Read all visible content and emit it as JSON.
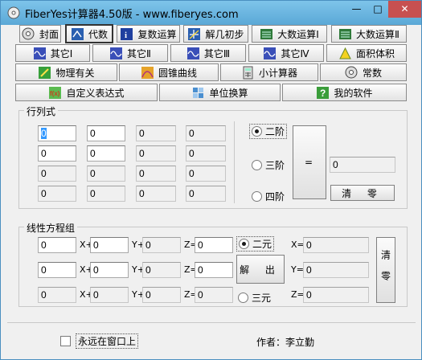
{
  "window": {
    "title": "FiberYes计算器4.50版 - www.fiberyes.com",
    "minimize": "—",
    "maximize": "□",
    "close": "✕"
  },
  "toolbar": {
    "row1": [
      {
        "label": "封面",
        "icon": "disc-icon"
      },
      {
        "label": "代数",
        "icon": "abacus-icon",
        "active": true
      },
      {
        "label": "复数运算",
        "icon": "info-icon"
      },
      {
        "label": "解几初步",
        "icon": "axes-icon"
      },
      {
        "label": "大数运算Ⅰ",
        "icon": "bignum-icon"
      },
      {
        "label": "大数运算Ⅱ",
        "icon": "bignum-icon"
      }
    ],
    "row2": [
      {
        "label": "其它Ⅰ",
        "icon": "wave-icon"
      },
      {
        "label": "其它Ⅱ",
        "icon": "wave-icon"
      },
      {
        "label": "其它Ⅲ",
        "icon": "wave-icon"
      },
      {
        "label": "其它Ⅳ",
        "icon": "wave-icon"
      },
      {
        "label": "面积体积",
        "icon": "triangle-icon"
      }
    ],
    "row3": [
      {
        "label": "物理有关",
        "icon": "physics-icon"
      },
      {
        "label": "圆锥曲线",
        "icon": "conic-icon"
      },
      {
        "label": "小计算器",
        "icon": "calculator-icon"
      },
      {
        "label": "常数",
        "icon": "disc-icon"
      }
    ],
    "row4": [
      {
        "label": "自定义表达式",
        "icon": "fx-icon"
      },
      {
        "label": "单位换算",
        "icon": "units-icon"
      },
      {
        "label": "我的软件",
        "icon": "help-icon"
      }
    ]
  },
  "determinant": {
    "title": "行列式",
    "cells": [
      [
        "0",
        "0",
        "0",
        "0"
      ],
      [
        "0",
        "0",
        "0",
        "0"
      ],
      [
        "0",
        "0",
        "0",
        "0"
      ],
      [
        "0",
        "0",
        "0",
        "0"
      ]
    ],
    "orders": [
      "二阶",
      "三阶",
      "四阶"
    ],
    "selected_order": "二阶",
    "equals_label": "=",
    "result": "0",
    "clear_label": "清 零"
  },
  "linear": {
    "title": "线性方程组",
    "rows": [
      {
        "a": "0",
        "b": "0",
        "c": "0",
        "d": "0"
      },
      {
        "a": "0",
        "b": "0",
        "c": "0",
        "d": "0"
      },
      {
        "a": "0",
        "b": "0",
        "c": "0",
        "d": "0"
      }
    ],
    "var_x": "X+",
    "var_y": "Y+",
    "var_z": "Z=",
    "orders": [
      "二元",
      "三元"
    ],
    "selected_order": "二元",
    "solve_label": "解 出",
    "result_labels": [
      "X=",
      "Y=",
      "Z="
    ],
    "results": [
      "0",
      "0",
      "0"
    ],
    "clear_label": "清零"
  },
  "footer": {
    "always_on_top": "永远在窗口上",
    "author": "作者：李立勤"
  },
  "colors": {
    "title_bar": "#7ec4ea",
    "close_button": "#c75050",
    "selection": "#3399ff"
  }
}
